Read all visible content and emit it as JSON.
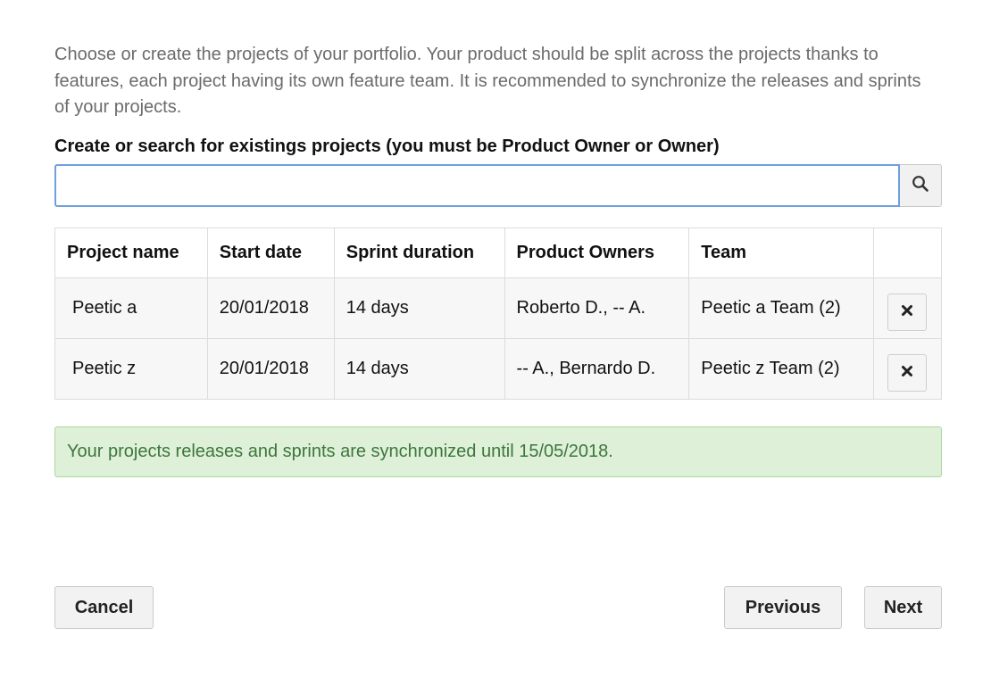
{
  "intro": {
    "text": "Choose or create the projects of your portfolio. Your product should be split across the projects thanks to features, each project having its own feature team. It is recommended to synchronize the releases and sprints of your projects."
  },
  "search": {
    "label": "Create or search for existings projects (you must be Product Owner or Owner)",
    "value": "",
    "placeholder": "",
    "icon": "search-icon"
  },
  "table": {
    "headers": [
      "Project name",
      "Start date",
      "Sprint duration",
      "Product Owners",
      "Team",
      ""
    ],
    "rows": [
      {
        "name": "Peetic a",
        "start_date": "20/01/2018",
        "sprint_duration": "14 days",
        "product_owners": "Roberto D., -- A.",
        "team": "Peetic a Team (2)",
        "remove_icon": "close-icon"
      },
      {
        "name": "Peetic z",
        "start_date": "20/01/2018",
        "sprint_duration": "14 days",
        "product_owners": "-- A., Bernardo D.",
        "team": "Peetic z Team (2)",
        "remove_icon": "close-icon"
      }
    ]
  },
  "alert": {
    "text": "Your projects releases and sprints are synchronized until 15/05/2018.",
    "color": "#3c763d",
    "background": "#dff0d8"
  },
  "footer": {
    "cancel_label": "Cancel",
    "previous_label": "Previous",
    "next_label": "Next"
  },
  "colors": {
    "input_border": "#6fa0dd",
    "muted_text": "#6b6b6b"
  }
}
